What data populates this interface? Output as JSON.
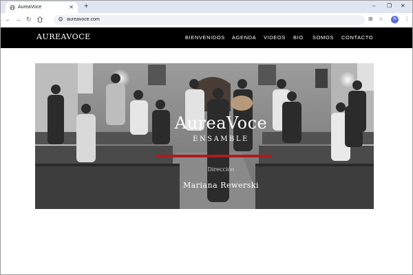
{
  "browser": {
    "tab_title": "AureaVoce",
    "tab_close": "✕",
    "new_tab": "+",
    "url": "aureavoce.com",
    "profile_initial": "N",
    "window_controls": [
      "–",
      "❐",
      "✕"
    ]
  },
  "site": {
    "logo": "AUREAVOCE",
    "nav": [
      "BIENVENIDOS",
      "AGENDA",
      "VIDEOS",
      "BIO",
      "SOMOS",
      "CONTACTO"
    ]
  },
  "hero": {
    "title": "AureaVoce",
    "subtitle": "ENSAMBLE",
    "director_label": "Dirección",
    "director_name": "Mariana Rewerski",
    "accent_color": "#b01a1f"
  }
}
